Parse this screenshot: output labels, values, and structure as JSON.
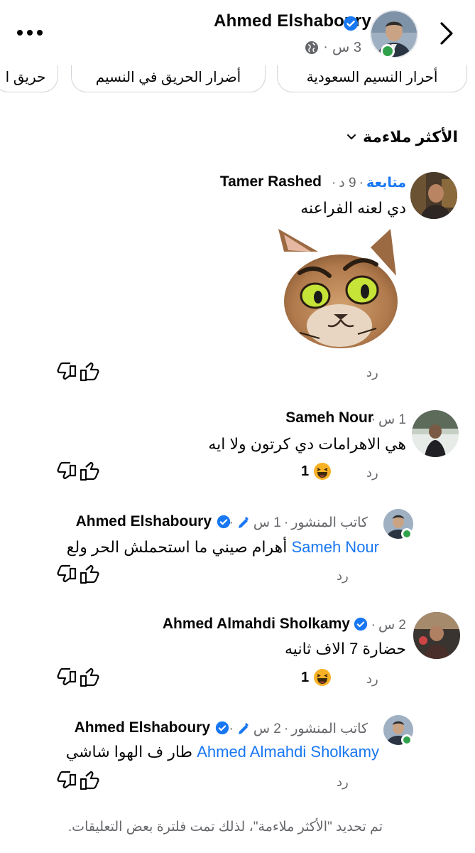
{
  "header": {
    "author": "Ahmed Elshaboury",
    "time": "3 س",
    "separator": "·"
  },
  "chips": [
    "حريق ا",
    "أضرار الحريق في النسيم",
    "أحرار النسيم السعودية"
  ],
  "sort": {
    "label": "الأكثر ملاءمة"
  },
  "comments": [
    {
      "name": "Tamer Rashed",
      "meta": "9 د",
      "follow": "متابعة",
      "text": "دي لعنه الفراعنه",
      "reply": "رد",
      "sticker": "cat-sticker"
    },
    {
      "name": "Sameh Nour",
      "meta": "1 س",
      "text": "هي الاهرامات دي كرتون ولا ايه",
      "reply": "رد",
      "reactions": "1"
    },
    {
      "name": "Ahmed Elshaboury",
      "meta": "1 س",
      "role": "كاتب المنشور",
      "mention": "Sameh Nour",
      "text": "أهرام صيني ما استحملش الحر ولع",
      "reply": "رد"
    },
    {
      "name": "Ahmed Almahdi Sholkamy",
      "meta": "2 س",
      "text": "حضارة 7 الاف ثانيه",
      "reply": "رد",
      "reactions": "1"
    },
    {
      "name": "Ahmed Elshaboury",
      "meta": "2 س",
      "role": "كاتب المنشور",
      "mention": "Ahmed Almahdi Sholkamy",
      "text": "طار ف الهوا شاشي",
      "reply": "رد"
    }
  ],
  "footer": "تم تحديد \"الأكثر ملاءمة\"، لذلك تمت فلترة بعض التعليقات.",
  "colors": {
    "link": "#1877f2",
    "muted": "#65676b",
    "online": "#31a24c",
    "haha": "#f7b125"
  }
}
